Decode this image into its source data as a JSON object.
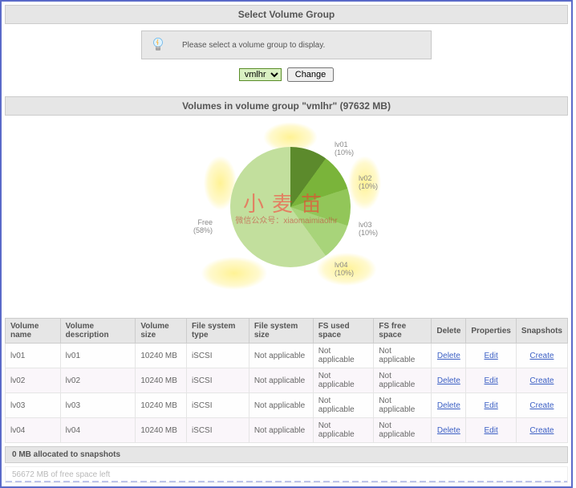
{
  "select_panel": {
    "title": "Select Volume Group",
    "tip": "Please select a volume group to display.",
    "dropdown_value": "vmlhr",
    "change_button": "Change"
  },
  "volumes_panel": {
    "title": "Volumes in volume group \"vmlhr\" (97632 MB)",
    "group_name": "vmlhr",
    "group_size_mb": 97632
  },
  "chart_data": {
    "type": "pie",
    "title": "",
    "series": [
      {
        "name": "lv01",
        "percent": 10
      },
      {
        "name": "lv02",
        "percent": 10
      },
      {
        "name": "lv03",
        "percent": 10
      },
      {
        "name": "lv04",
        "percent": 10
      },
      {
        "name": "Free",
        "percent": 58
      }
    ],
    "labels": {
      "lv01": "lv01\n(10%)",
      "lv02": "lv02\n(10%)",
      "lv03": "lv03\n(10%)",
      "lv04": "lv04\n(10%)",
      "free": "Free\n(58%)"
    }
  },
  "watermark": {
    "main": "小麦苗",
    "sub": "微信公众号：xiaomaimiaolhr"
  },
  "table": {
    "headers": {
      "name": "Volume name",
      "desc": "Volume description",
      "size": "Volume size",
      "fstype": "File system type",
      "fssize": "File system size",
      "fsused": "FS used space",
      "fsfree": "FS free space",
      "delete": "Delete",
      "props": "Properties",
      "snaps": "Snapshots"
    },
    "rows": [
      {
        "name": "lv01",
        "desc": "lv01",
        "size": "10240 MB",
        "fstype": "iSCSI",
        "fssize": "Not applicable",
        "fsused": "Not applicable",
        "fsfree": "Not applicable"
      },
      {
        "name": "lv02",
        "desc": "lv02",
        "size": "10240 MB",
        "fstype": "iSCSI",
        "fssize": "Not applicable",
        "fsused": "Not applicable",
        "fsfree": "Not applicable"
      },
      {
        "name": "lv03",
        "desc": "lv03",
        "size": "10240 MB",
        "fstype": "iSCSI",
        "fssize": "Not applicable",
        "fsused": "Not applicable",
        "fsfree": "Not applicable"
      },
      {
        "name": "lv04",
        "desc": "lv04",
        "size": "10240 MB",
        "fstype": "iSCSI",
        "fssize": "Not applicable",
        "fsused": "Not applicable",
        "fsfree": "Not applicable"
      }
    ],
    "actions": {
      "delete": "Delete",
      "edit": "Edit",
      "create": "Create"
    }
  },
  "footer": {
    "snapshots": "0 MB allocated to snapshots",
    "freespace": "56672 MB of free space left"
  }
}
